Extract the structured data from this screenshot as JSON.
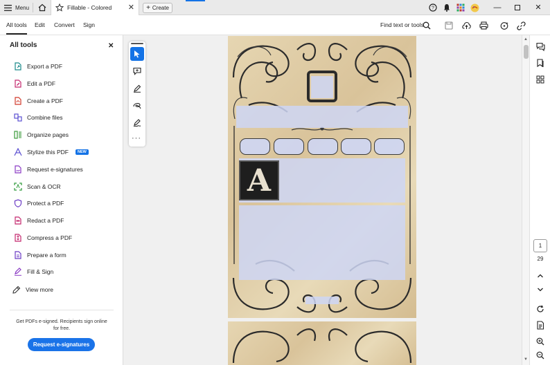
{
  "titlebar": {
    "menu_label": "Menu",
    "tab_title": "Fillable - Colored",
    "create_label": "Create"
  },
  "menubar": {
    "items": [
      "All tools",
      "Edit",
      "Convert",
      "Sign"
    ],
    "active": "All tools",
    "find_label": "Find text or tools"
  },
  "left_panel": {
    "title": "All tools",
    "tools": [
      {
        "label": "Export a PDF",
        "icon": "export-pdf-icon",
        "color": "#1a8a8a"
      },
      {
        "label": "Edit a PDF",
        "icon": "edit-pdf-icon",
        "color": "#c4286e"
      },
      {
        "label": "Create a PDF",
        "icon": "create-pdf-icon",
        "color": "#d1392b"
      },
      {
        "label": "Combine files",
        "icon": "combine-files-icon",
        "color": "#5b4fd1"
      },
      {
        "label": "Organize pages",
        "icon": "organize-pages-icon",
        "color": "#3a9a3a"
      },
      {
        "label": "Stylize this PDF",
        "icon": "stylize-pdf-icon",
        "color": "#5b4fd1",
        "badge": "NEW"
      },
      {
        "label": "Request e-signatures",
        "icon": "request-esign-icon",
        "color": "#8a3ac4"
      },
      {
        "label": "Scan & OCR",
        "icon": "scan-ocr-icon",
        "color": "#2e9a3a"
      },
      {
        "label": "Protect a PDF",
        "icon": "protect-pdf-icon",
        "color": "#6a3ac4"
      },
      {
        "label": "Redact a PDF",
        "icon": "redact-pdf-icon",
        "color": "#c4286e"
      },
      {
        "label": "Compress a PDF",
        "icon": "compress-pdf-icon",
        "color": "#c4286e"
      },
      {
        "label": "Prepare a form",
        "icon": "prepare-form-icon",
        "color": "#6a3ac4"
      },
      {
        "label": "Fill & Sign",
        "icon": "fill-sign-icon",
        "color": "#8a3ac4"
      },
      {
        "label": "View more",
        "icon": "view-more-icon",
        "color": "#333333"
      }
    ],
    "promo_text": "Get PDFs e-signed. Recipients sign online for free.",
    "promo_button": "Request e-signatures"
  },
  "document": {
    "dropcap_letter": "A"
  },
  "page_nav": {
    "current_page": "1",
    "total_pages": "29"
  },
  "colors": {
    "accent": "#1473e6",
    "field_fill": "#ced6f4",
    "parchment": "#ddc9a2"
  }
}
